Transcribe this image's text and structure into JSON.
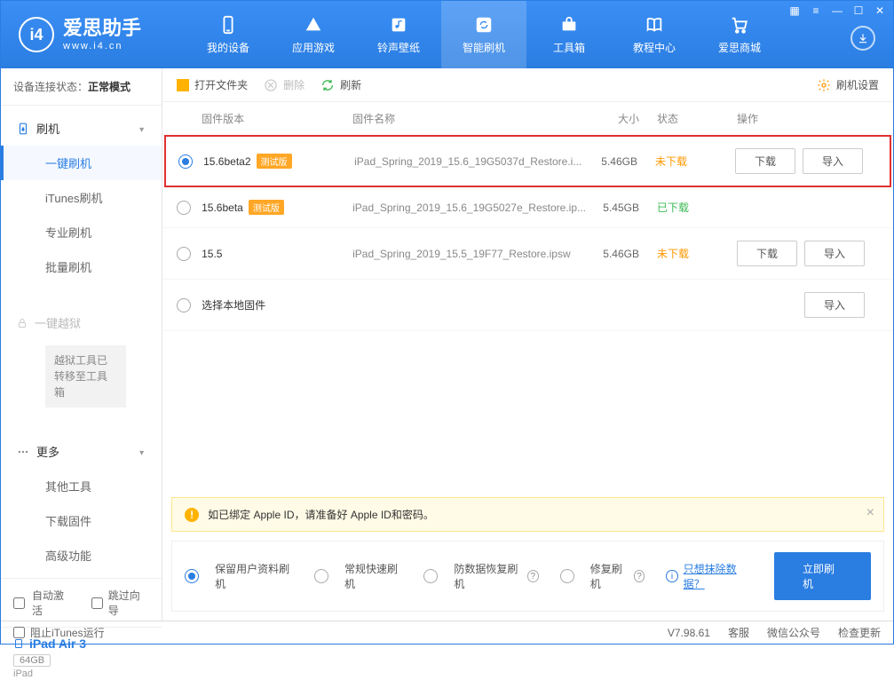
{
  "brand": {
    "name": "爱思助手",
    "url": "www.i4.cn",
    "logo_letter": "i4"
  },
  "nav": [
    {
      "label": "我的设备"
    },
    {
      "label": "应用游戏"
    },
    {
      "label": "铃声壁纸"
    },
    {
      "label": "智能刷机",
      "active": true
    },
    {
      "label": "工具箱"
    },
    {
      "label": "教程中心"
    },
    {
      "label": "爱思商城"
    }
  ],
  "sidebar": {
    "conn_label": "设备连接状态：",
    "conn_value": "正常模式",
    "flash_header": "刷机",
    "items": [
      "一键刷机",
      "iTunes刷机",
      "专业刷机",
      "批量刷机"
    ],
    "jailbreak_header": "一键越狱",
    "jailbreak_note": "越狱工具已转移至工具箱",
    "more_header": "更多",
    "more_items": [
      "其他工具",
      "下载固件",
      "高级功能"
    ],
    "auto_activate": "自动激活",
    "skip_guide": "跳过向导",
    "device_name": "iPad Air 3",
    "device_cap": "64GB",
    "device_type": "iPad"
  },
  "toolbar": {
    "open": "打开文件夹",
    "delete": "删除",
    "refresh": "刷新",
    "settings": "刷机设置"
  },
  "columns": {
    "version": "固件版本",
    "name": "固件名称",
    "size": "大小",
    "status": "状态",
    "ops": "操作"
  },
  "rows": [
    {
      "version": "15.6beta2",
      "beta": "测试版",
      "name": "iPad_Spring_2019_15.6_19G5037d_Restore.i...",
      "size": "5.46GB",
      "status": "未下载",
      "status_color": "orange",
      "selected": true,
      "highlight": true,
      "show_ops": true
    },
    {
      "version": "15.6beta",
      "beta": "测试版",
      "name": "iPad_Spring_2019_15.6_19G5027e_Restore.ip...",
      "size": "5.45GB",
      "status": "已下载",
      "status_color": "green",
      "selected": false,
      "show_ops": false
    },
    {
      "version": "15.5",
      "beta": "",
      "name": "iPad_Spring_2019_15.5_19F77_Restore.ipsw",
      "size": "5.46GB",
      "status": "未下载",
      "status_color": "orange",
      "selected": false,
      "show_ops": true
    },
    {
      "version": "选择本地固件",
      "beta": "",
      "name": "",
      "size": "",
      "status": "",
      "status_color": "",
      "selected": false,
      "show_ops": false,
      "import_only": true
    }
  ],
  "buttons": {
    "download": "下载",
    "import": "导入"
  },
  "notice": "如已绑定 Apple ID，请准备好 Apple ID和密码。",
  "flash_options": [
    "保留用户资料刷机",
    "常规快速刷机",
    "防数据恢复刷机",
    "修复刷机"
  ],
  "erase_link": "只想抹除数据？",
  "flash_now": "立即刷机",
  "statusbar": {
    "block_itunes": "阻止iTunes运行",
    "version": "V7.98.61",
    "service": "客服",
    "wechat": "微信公众号",
    "check_update": "检查更新"
  }
}
